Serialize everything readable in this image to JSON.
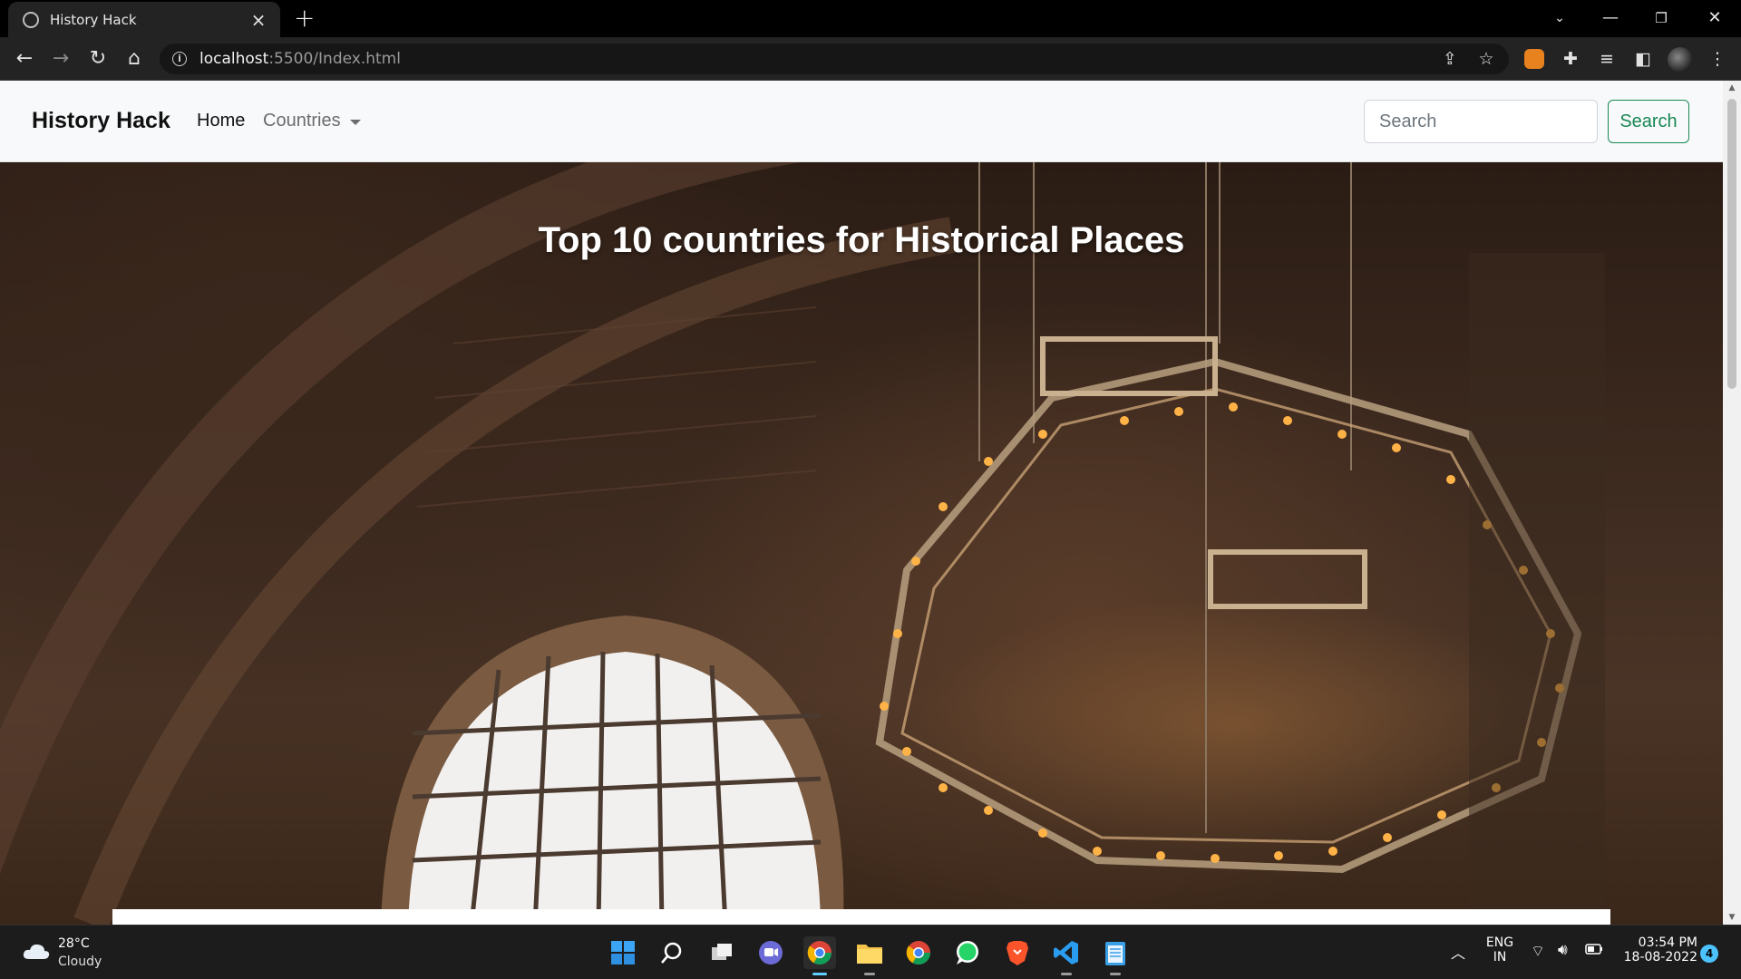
{
  "browser": {
    "tab_title": "History Hack",
    "new_tab_symbol": "+",
    "url_host": "localhost",
    "url_path": ":5500/Index.html"
  },
  "page": {
    "navbar": {
      "brand": "History Hack",
      "links": [
        "Home",
        "Countries"
      ],
      "search_placeholder": "Search",
      "search_button": "Search"
    },
    "hero": {
      "title": "Top 10 countries for Historical Places"
    }
  },
  "taskbar": {
    "weather": {
      "temp": "28°C",
      "condition": "Cloudy"
    },
    "language": {
      "lang": "ENG",
      "region": "IN"
    },
    "clock": {
      "time": "03:54 PM",
      "date": "18-08-2022"
    },
    "notifications": "4"
  },
  "colors": {
    "success_green": "#198754",
    "navbar_bg": "#f8f9fa",
    "chrome_dark": "#232323"
  }
}
